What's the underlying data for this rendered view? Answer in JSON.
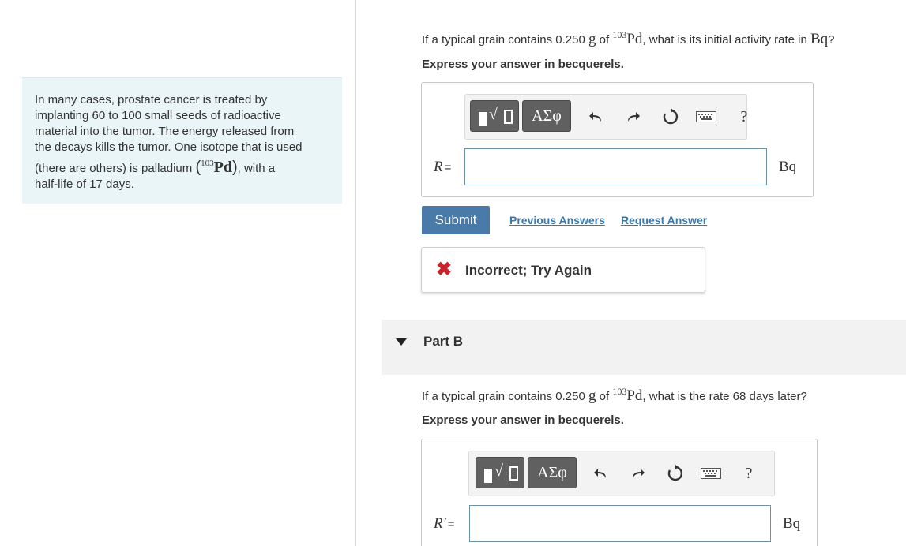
{
  "intro": {
    "line1": "In many cases, prostate cancer is treated by",
    "line2": "implanting 60 to 100 small seeds of radioactive",
    "line3": "material into the tumor. The energy released from",
    "line4": "the decays kills the tumor. One isotope that is used",
    "line5_pre": "(there are others) is palladium",
    "isotope_mass": "103",
    "isotope_symbol": "Pd",
    "line5_post": ", with a",
    "line6": "half-life of 17 days."
  },
  "partA": {
    "q_pre": "If a typical grain contains 0.250",
    "q_g": "g",
    "q_of": "of",
    "isotope_mass": "103",
    "isotope_symbol": "Pd",
    "q_post": ", what is its initial activity rate in",
    "q_unit": "Bq",
    "q_end": "?",
    "express": "Express your answer in becquerels.",
    "var": "R",
    "eq": "=",
    "input_value": "",
    "unit": "Bq",
    "submit": "Submit",
    "previous_answers": "Previous Answers",
    "request_answer": "Request Answer",
    "feedback_icon": "✖",
    "feedback": "Incorrect; Try Again"
  },
  "toolbar": {
    "greek": "ΑΣφ",
    "help": "?",
    "icons": [
      "template-icon",
      "undo-icon",
      "redo-icon",
      "reset-icon",
      "keyboard-icon",
      "help-icon"
    ]
  },
  "partB": {
    "title": "Part B",
    "q_pre": "If a typical grain contains 0.250",
    "q_g": "g",
    "q_of": "of",
    "isotope_mass": "103",
    "isotope_symbol": "Pd",
    "q_post": ", what is the rate 68 days later?",
    "express": "Express your answer in becquerels.",
    "var": "R′",
    "eq": "=",
    "input_value": "",
    "unit": "Bq"
  },
  "colors": {
    "intro_bg": "#eaf5f7",
    "submit_bg": "#4a7ba8",
    "link": "#3878ad",
    "error": "#c9222a",
    "toolbar_btn": "#606060"
  }
}
